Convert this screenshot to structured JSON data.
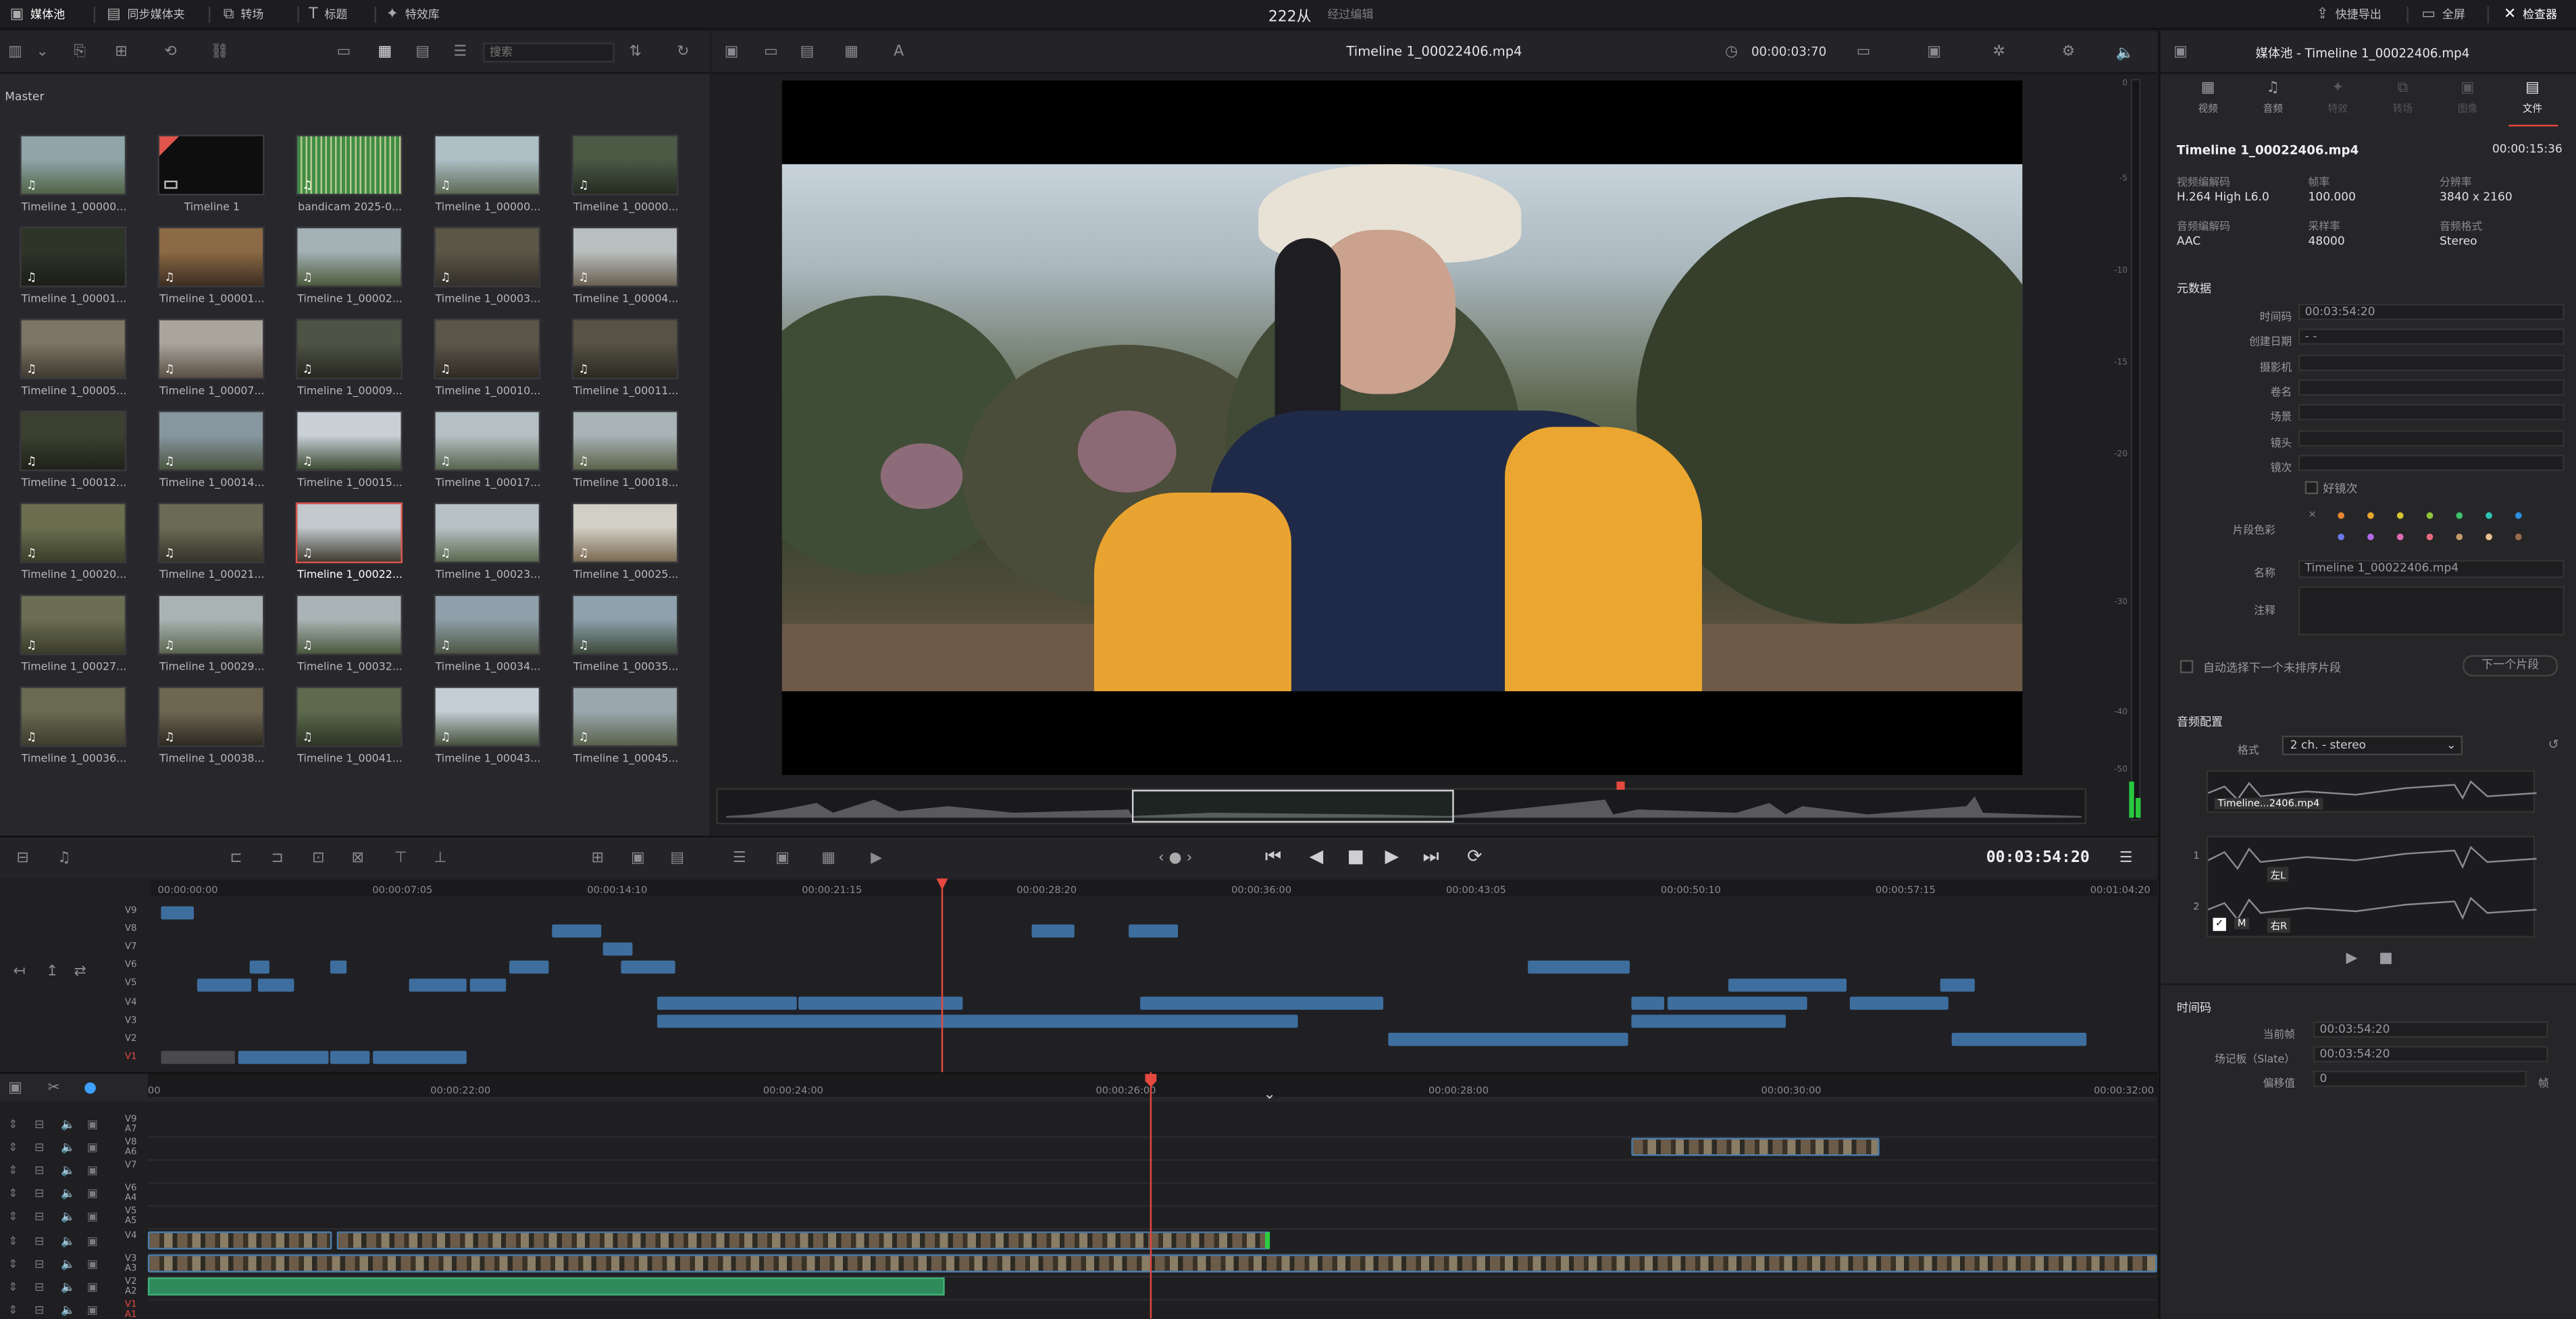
{
  "topbar": {
    "media_pool": "媒体池",
    "sync_bin": "同步媒体夹",
    "transitions": "转场",
    "titles": "标题",
    "effects": "特效库",
    "project_title": "222从",
    "edited_status": "经过编辑",
    "quick_export": "快捷导出",
    "fullscreen": "全屏",
    "inspector": "检查器"
  },
  "media_pool": {
    "search_placeholder": "搜索",
    "bin_name": "Master",
    "clips": [
      {
        "label": "Timeline 1_00000...",
        "colors": [
          "#8fa5a8",
          "#516447"
        ],
        "audio": true
      },
      {
        "label": "Timeline 1",
        "colors": [
          "#0e0e0e",
          "#0e0e0e"
        ],
        "audio": false,
        "timeline": true
      },
      {
        "label": "bandicam 2025-0...",
        "colors": [
          "#3e6a3e",
          "#2a402a"
        ],
        "audio": true,
        "wave": true
      },
      {
        "label": "Timeline 1_00000...",
        "colors": [
          "#aebfc6",
          "#5d6a55"
        ],
        "audio": true
      },
      {
        "label": "Timeline 1_00000...",
        "colors": [
          "#4a5a45",
          "#252b22"
        ],
        "audio": true
      },
      {
        "label": "Timeline 1_00001...",
        "colors": [
          "#2e3428",
          "#1b1f18"
        ],
        "audio": true
      },
      {
        "label": "Timeline 1_00001...",
        "colors": [
          "#8b6a45",
          "#3d2e22"
        ],
        "audio": true
      },
      {
        "label": "Timeline 1_00002...",
        "colors": [
          "#a4b1b5",
          "#4c5a3c"
        ],
        "audio": true
      },
      {
        "label": "Timeline 1_00003...",
        "colors": [
          "#5b5646",
          "#33302a"
        ],
        "audio": true
      },
      {
        "label": "Timeline 1_00004...",
        "colors": [
          "#b9bfbf",
          "#6a6152"
        ],
        "audio": true
      },
      {
        "label": "Timeline 1_00005...",
        "colors": [
          "#7d7565",
          "#3f3a30"
        ],
        "audio": true
      },
      {
        "label": "Timeline 1_00007...",
        "colors": [
          "#a9a59d",
          "#5a5044"
        ],
        "audio": true
      },
      {
        "label": "Timeline 1_00009...",
        "colors": [
          "#4f5345",
          "#262820"
        ],
        "audio": true
      },
      {
        "label": "Timeline 1_00010...",
        "colors": [
          "#5c564a",
          "#2f2b24"
        ],
        "audio": true
      },
      {
        "label": "Timeline 1_00011...",
        "colors": [
          "#565245",
          "#2c2a22"
        ],
        "audio": true
      },
      {
        "label": "Timeline 1_00012...",
        "colors": [
          "#3b4030",
          "#1f2218"
        ],
        "audio": true
      },
      {
        "label": "Timeline 1_00014...",
        "colors": [
          "#8797a0",
          "#4b5540"
        ],
        "audio": true
      },
      {
        "label": "Timeline 1_00015...",
        "colors": [
          "#c8d0d6",
          "#3c4a32"
        ],
        "audio": true
      },
      {
        "label": "Timeline 1_00017...",
        "colors": [
          "#b5c0c4",
          "#57654f"
        ],
        "audio": true
      },
      {
        "label": "Timeline 1_00018...",
        "colors": [
          "#a8b3b6",
          "#5c6349"
        ],
        "audio": true
      },
      {
        "label": "Timeline 1_00020...",
        "colors": [
          "#6b6f4f",
          "#3c3e2a"
        ],
        "audio": true
      },
      {
        "label": "Timeline 1_00021...",
        "colors": [
          "#6a6a55",
          "#34342a"
        ],
        "audio": true
      },
      {
        "label": "Timeline 1_00022...",
        "colors": [
          "#c3c9cd",
          "#3f3b30"
        ],
        "audio": true,
        "selected": true
      },
      {
        "label": "Timeline 1_00023...",
        "colors": [
          "#b7c2c6",
          "#5b6a50"
        ],
        "audio": true
      },
      {
        "label": "Timeline 1_00025...",
        "colors": [
          "#d2cfc7",
          "#7b6a52"
        ],
        "audio": true
      },
      {
        "label": "Timeline 1_00027...",
        "colors": [
          "#6b6e52",
          "#3a3c2a"
        ],
        "audio": true
      },
      {
        "label": "Timeline 1_00029...",
        "colors": [
          "#a9b3b3",
          "#5b6650"
        ],
        "audio": true
      },
      {
        "label": "Timeline 1_00032...",
        "colors": [
          "#aab4b6",
          "#4c5a3e"
        ],
        "audio": true
      },
      {
        "label": "Timeline 1_00034...",
        "colors": [
          "#8fa0aa",
          "#4d5645"
        ],
        "audio": true
      },
      {
        "label": "Timeline 1_00035...",
        "colors": [
          "#8ea1ad",
          "#3d4a3a"
        ],
        "audio": true
      },
      {
        "label": "Timeline 1_00036...",
        "colors": [
          "#6a6a52",
          "#3d3c2e"
        ],
        "audio": true
      },
      {
        "label": "Timeline 1_00038...",
        "colors": [
          "#6f6650",
          "#2d2a22"
        ],
        "audio": true
      },
      {
        "label": "Timeline 1_00041...",
        "colors": [
          "#5d6a4d",
          "#2d3526"
        ],
        "audio": true
      },
      {
        "label": "Timeline 1_00043...",
        "colors": [
          "#c4ced4",
          "#45513c"
        ],
        "audio": true
      },
      {
        "label": "Timeline 1_00045...",
        "colors": [
          "#9aa7ac",
          "#59634c"
        ],
        "audio": true
      }
    ]
  },
  "viewer": {
    "title": "Timeline 1_00022406.mp4",
    "timecode": "00:00:03:70",
    "current_timecode": "00:03:54:20"
  },
  "inspector": {
    "header": "媒体池 - Timeline 1_00022406.mp4",
    "tabs": [
      "视频",
      "音频",
      "特效",
      "转场",
      "图像",
      "文件"
    ],
    "active_tab": "文件",
    "file_name": "Timeline 1_00022406.mp4",
    "duration": "00:00:15:36",
    "props": [
      {
        "k": "视频编解码",
        "v": "H.264 High L6.0"
      },
      {
        "k": "帧率",
        "v": "100.000"
      },
      {
        "k": "分辨率",
        "v": "3840 x 2160"
      },
      {
        "k": "音频编解码",
        "v": "AAC"
      },
      {
        "k": "采样率",
        "v": "48000"
      },
      {
        "k": "音频格式",
        "v": "Stereo"
      }
    ],
    "metadata_title": "元数据",
    "meta_fields": [
      {
        "k": "时间码",
        "v": "00:03:54:20"
      },
      {
        "k": "创建日期",
        "v": "- -"
      },
      {
        "k": "摄影机",
        "v": ""
      },
      {
        "k": "卷名",
        "v": ""
      },
      {
        "k": "场景",
        "v": ""
      },
      {
        "k": "镜头",
        "v": ""
      },
      {
        "k": "镜次",
        "v": ""
      }
    ],
    "good_take": "好镜次",
    "clip_color_label": "片段色彩",
    "clip_colors": [
      "#e8862e",
      "#e7a62e",
      "#d6c42e",
      "#8fc43c",
      "#3cc46a",
      "#2ec4b4",
      "#2e8ee0",
      "#6a78e8",
      "#b46ae8",
      "#e06ab4",
      "#e86a7e",
      "#c29a6a",
      "#e8c48c",
      "#9a6a4a"
    ],
    "name_label": "名称",
    "name_value": "Timeline 1_00022406.mp4",
    "comment_label": "注释",
    "auto_select": "自动选择下一个未排序片段",
    "next_clip": "下一个片段",
    "audio_config_title": "音频配置",
    "format_label": "格式",
    "format_value": "2 ch. - stereo",
    "wave_tag": "Timeline...2406.mp4",
    "ch1": "左L",
    "ch2": "右R",
    "mute": "M",
    "ch_numbers": [
      "1",
      "2"
    ],
    "timecode_title": "时间码",
    "current_frame_label": "当前帧",
    "current_frame": "00:03:54:20",
    "slate_label": "场记板（Slate）",
    "slate": "00:03:54:20",
    "offset_label": "偏移值",
    "offset": "0",
    "offset_unit": "帧"
  },
  "transport": {
    "timecode": "00:03:54:20"
  },
  "upper_timeline": {
    "ruler": [
      "00:00:00:00",
      "00:00:07:05",
      "00:00:14:10",
      "00:00:21:15",
      "00:00:28:20",
      "00:00:36:00",
      "00:00:43:05",
      "00:00:50:10",
      "00:00:57:15",
      "00:01:04:20"
    ],
    "tracks": [
      "V9",
      "V8",
      "V7",
      "V6",
      "V5",
      "V4",
      "V3",
      "V2",
      "V1"
    ]
  },
  "lower_timeline": {
    "ruler": [
      "00:00:22:00",
      "00:00:24:00",
      "00:00:26:00",
      "00:00:28:00",
      "00:00:30:00",
      "00:00:32:00"
    ],
    "ruler_start": "00",
    "tracks": [
      {
        "v": "V9",
        "a": "A7"
      },
      {
        "v": "V8",
        "a": "A6"
      },
      {
        "v": "V7",
        "a": ""
      },
      {
        "v": "V6",
        "a": "A4"
      },
      {
        "v": "V5",
        "a": "A5"
      },
      {
        "v": "V4",
        "a": ""
      },
      {
        "v": "V3",
        "a": "A3"
      },
      {
        "v": "V2",
        "a": "A2"
      },
      {
        "v": "V1",
        "a": "A1"
      }
    ]
  },
  "vu_scale": [
    "0",
    "-5",
    "-10",
    "-15",
    "-20",
    "-30",
    "-40",
    "-50"
  ]
}
